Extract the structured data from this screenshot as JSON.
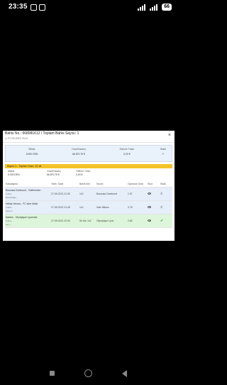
{
  "status_bar": {
    "time": "23:35",
    "battery": "66"
  },
  "modal": {
    "title": "Bahis No.: 668981612 / Toplam Bahis Sayısı: 1",
    "subtitle": "27-09-2021 23:21",
    "close_label": "×",
    "summary": {
      "stake_label": "Miktar",
      "stake_value": "5.000 DEN",
      "total_odds_label": "Oran/Kazanç",
      "total_odds_value": "66.870,75 €",
      "payout_label": "Ödeme Tutarı",
      "payout_value": "0,00 €",
      "status_label": "Statü",
      "status_value": "⏱"
    },
    "coupon_bar": "Kupon 1 - Toplam Oran: 12,18",
    "coupon_info": {
      "stake_label": "Miktar",
      "stake_value": "5.000 DEN",
      "odds_label": "Oran/Kazanç",
      "odds_value": "66.870,75 €",
      "payout_label": "Ödeme Tutarı",
      "payout_value": "0,00 €"
    },
    "table": {
      "headers": [
        "Karşılaşma",
        "Tarih / Saat",
        "Bahis türü",
        "Seçim",
        "Oynanan Oran",
        "Skor",
        "Statü"
      ],
      "rows": [
        {
          "match": "Borussia Dortmund - Hoffenheim",
          "sport": "Futbol",
          "league": "Bundesliga",
          "date": "27-09-2021 21:30",
          "bet_type": "1x2",
          "selection": "Borussia Dortmund",
          "odds": "1.57",
          "status": "⏱"
        },
        {
          "match": "Hellas Verona - FC Inter Milan",
          "sport": "Futbol",
          "league": "Serie A",
          "date": "27-09-2021 21:45",
          "bet_type": "1x2",
          "selection": "Inter Milano",
          "odds": "2.75",
          "status": "⏱"
        },
        {
          "match": "Nantes - Olympique Lyonnais",
          "sport": "Futbol",
          "league": "Lig 1",
          "date": "27-09-2021 22:00",
          "bet_type": "İlk Yarı 1x2",
          "selection": "Olympique Lyon",
          "odds": "2.82",
          "status": "✔"
        }
      ]
    }
  }
}
